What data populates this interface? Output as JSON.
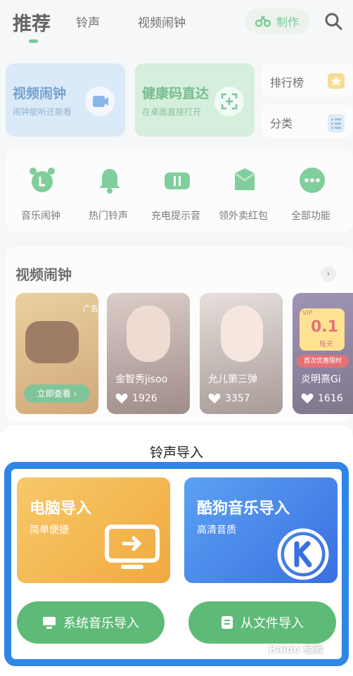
{
  "nav": {
    "tabs": [
      "推荐",
      "铃声",
      "视频闹钟"
    ],
    "make_label": "制作"
  },
  "features": {
    "video_alarm": {
      "title": "视频闹钟",
      "subtitle": "闹钟能听还能看"
    },
    "health_code": {
      "title": "健康码直达",
      "subtitle": "在桌面直接打开"
    },
    "ranking": "排行榜",
    "category": "分类"
  },
  "quick_actions": [
    "音乐闹钟",
    "热门铃声",
    "充电提示音",
    "领外卖红包",
    "全部功能"
  ],
  "video_section": {
    "title": "视频闹钟",
    "ad_badge": "广告",
    "ad_button": "立即查看 ›",
    "items": [
      {
        "name": "金智秀jisoo",
        "likes": "1926"
      },
      {
        "name": "允儿第三弹",
        "likes": "3357"
      },
      {
        "name": "炎明熹Gi",
        "likes": "1616"
      }
    ],
    "promo_vip": "VIP",
    "promo_price": "0.1",
    "promo_days": "每天",
    "promo_label": "首次优惠限时"
  },
  "sheet": {
    "title": "铃声导入",
    "pc_import": {
      "title": "电脑导入",
      "subtitle": "简单便捷"
    },
    "kugou_import": {
      "title": "酷狗音乐导入",
      "subtitle": "高清音质"
    },
    "system_button": "系统音乐导入",
    "file_button": "从文件导入"
  },
  "watermark": "Baidu 经验",
  "colors": {
    "brand_green": "#2fae5d",
    "button_green": "#5ebb77",
    "highlight_blue": "#2f86e6"
  }
}
